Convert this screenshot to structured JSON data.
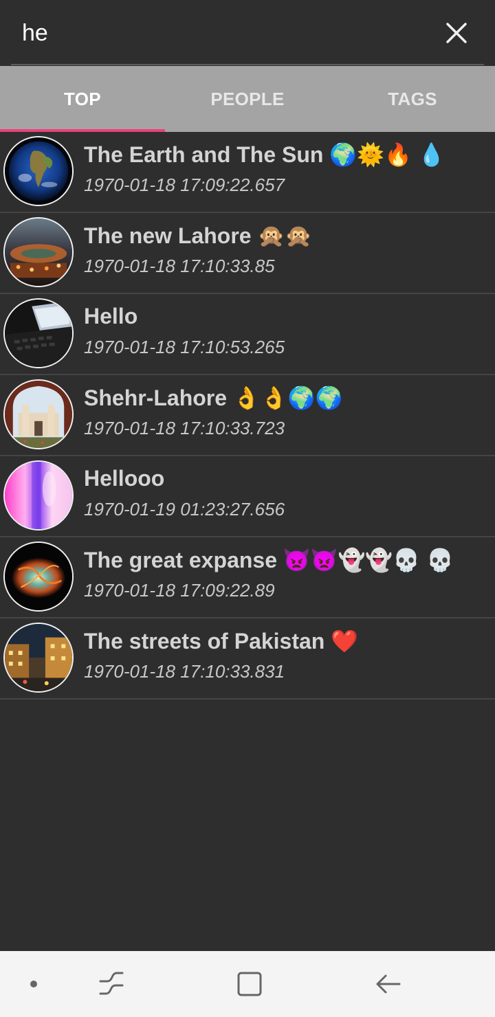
{
  "search": {
    "value": "he",
    "clear_icon": "close-icon"
  },
  "tabs": [
    {
      "label": "TOP",
      "active": true
    },
    {
      "label": "PEOPLE",
      "active": false
    },
    {
      "label": "TAGS",
      "active": false
    }
  ],
  "colors": {
    "accent": "#ec407a",
    "background": "#2e2e2e",
    "tab_bar": "#a4a4a4"
  },
  "results": [
    {
      "title": "The Earth and The Sun 🌍🌞🔥 💧",
      "timestamp": "1970-01-18 17:09:22.657",
      "avatar": "earth-avatar"
    },
    {
      "title": "The new Lahore 🙊🙊",
      "timestamp": "1970-01-18 17:10:33.85",
      "avatar": "lahore-night-avatar"
    },
    {
      "title": "Hello",
      "timestamp": "1970-01-18 17:10:53.265",
      "avatar": "laptop-avatar"
    },
    {
      "title": "Shehr-Lahore 👌👌🌍🌍",
      "timestamp": "1970-01-18 17:10:33.723",
      "avatar": "fort-avatar"
    },
    {
      "title": "Hellooo",
      "timestamp": "1970-01-19 01:23:27.656",
      "avatar": "pink-blur-avatar"
    },
    {
      "title": "The great expanse 👿👿👻👻💀 💀",
      "timestamp": "1970-01-18 17:09:22.89",
      "avatar": "nebula-avatar"
    },
    {
      "title": "The streets of Pakistan ❤️",
      "timestamp": "1970-01-18 17:10:33.831",
      "avatar": "street-avatar"
    }
  ],
  "navbar": {
    "items": [
      "dot-icon",
      "recent-apps-icon",
      "home-icon",
      "back-icon"
    ]
  }
}
